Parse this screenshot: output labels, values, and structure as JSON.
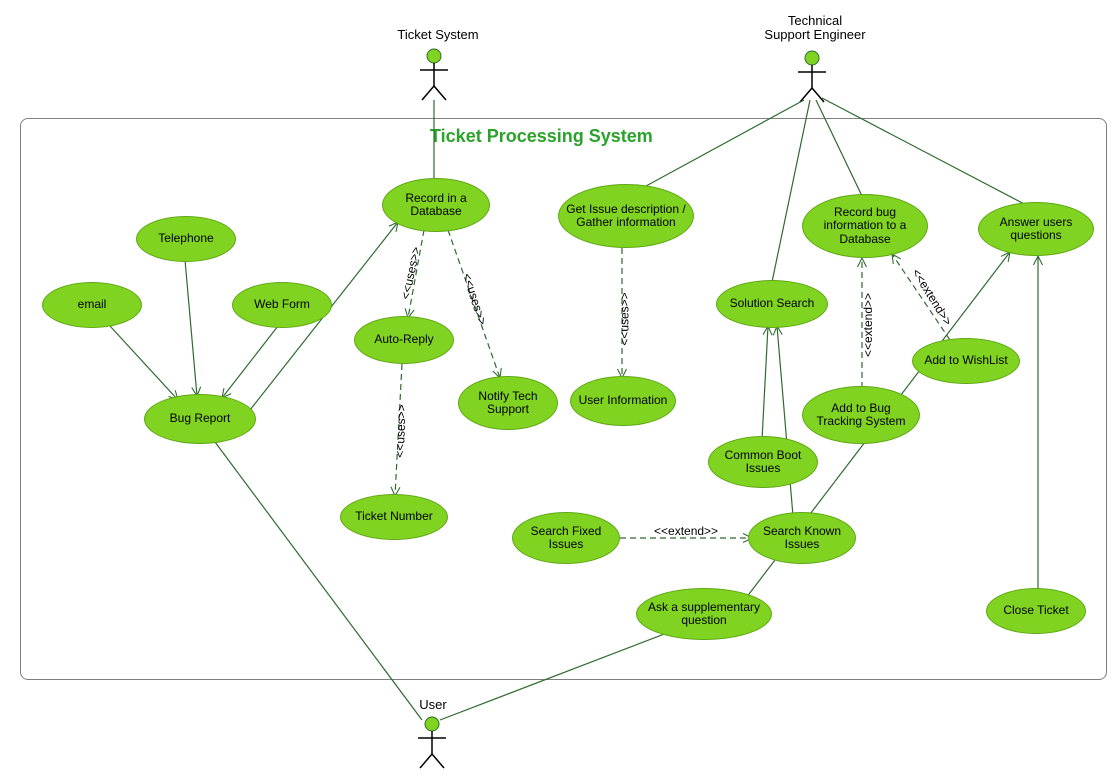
{
  "title": "Ticket Processing System",
  "actors": {
    "ticket_system": "Ticket System",
    "tech_engineer_line1": "Technical",
    "tech_engineer_line2": "Support Engineer",
    "user": "User"
  },
  "usecases": {
    "record_db": "Record in a Database",
    "get_issue": "Get Issue description / Gather information",
    "record_bug": "Record bug information to a Database",
    "answer_users": "Answer users questions",
    "telephone": "Telephone",
    "email": "email",
    "webform": "Web Form",
    "bug_report": "Bug Report",
    "auto_reply": "Auto-Reply",
    "notify_tech": "Notify Tech Support",
    "user_info": "User Information",
    "solution_search": "Solution Search",
    "add_wishlist": "Add to WishList",
    "add_bugtrack": "Add to Bug Tracking System",
    "ticket_number": "Ticket Number",
    "common_boot": "Common Boot Issues",
    "search_fixed": "Search Fixed Issues",
    "search_known": "Search Known Issues",
    "ask_supp": "Ask a supplementary question",
    "close_ticket": "Close Ticket"
  },
  "stereotypes": {
    "uses": "<<uses>>",
    "uses_r": "<<uses>>",
    "extend": "<<extend>>",
    "extend_r": "<<extend>>"
  },
  "colors": {
    "usecase_fill": "#80d320",
    "usecase_stroke": "#5fa815",
    "line_dark": "#2e6b2e",
    "title": "#29a329"
  }
}
